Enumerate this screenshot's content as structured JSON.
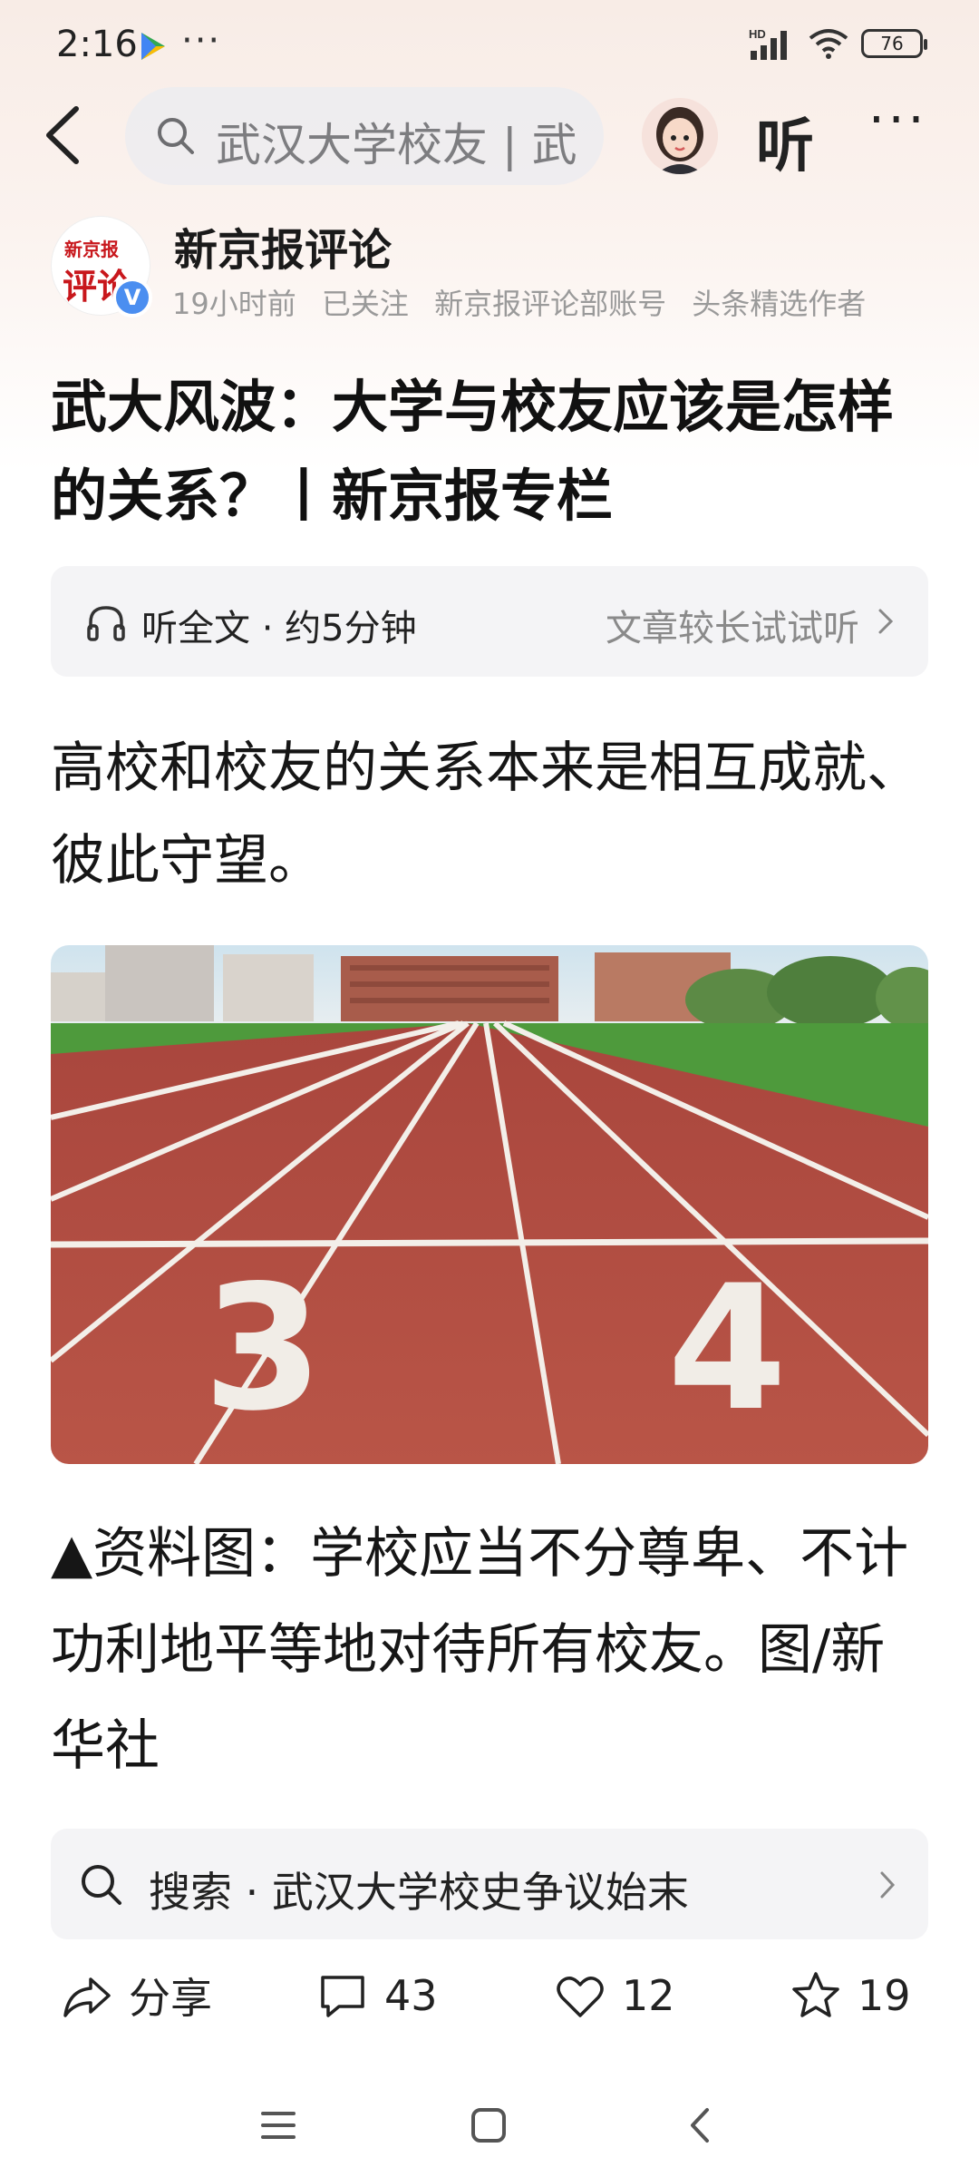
{
  "status_bar": {
    "time": "2:16",
    "more": "···",
    "battery": "76",
    "network": "HD"
  },
  "top_nav": {
    "search_text": "武汉大学校友 | 武",
    "listen_label": "听",
    "more_label": "···"
  },
  "author": {
    "logo_line1": "新京报",
    "logo_line2": "评论",
    "verified": "V",
    "name": "新京报评论",
    "meta": [
      "19小时前",
      "已关注",
      "新京报评论部账号",
      "头条精选作者"
    ]
  },
  "article": {
    "title": "武大风波：大学与校友应该是怎样的关系？丨新京报专栏",
    "listen_full": "听全文 · 约5分钟",
    "listen_hint": "文章较长试试听",
    "lead": "高校和校友的关系本来是相互成就、彼此守望。",
    "photo_numbers": [
      "3",
      "4"
    ],
    "caption": "▲资料图：学校应当不分尊卑、不计功利地平等地对待所有校友。图/新华社"
  },
  "related_search": {
    "text": "搜索 · 武汉大学校史争议始末"
  },
  "actions": {
    "share": "分享",
    "comments": "43",
    "likes": "12",
    "favorites": "19"
  },
  "colors": {
    "track": "#b84a3f",
    "grass": "#4e9a3c",
    "brand_red": "#c8171c",
    "verified_blue": "#4b8ef0"
  }
}
